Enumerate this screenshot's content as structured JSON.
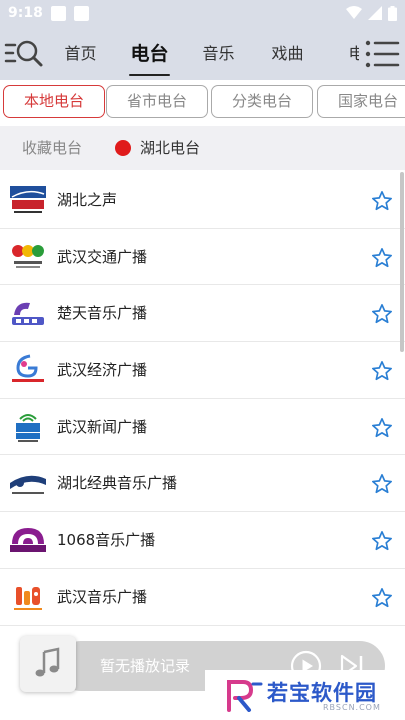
{
  "status_bar": {
    "time": "9:18"
  },
  "header": {
    "tabs": [
      {
        "label": "首页"
      },
      {
        "label": "电台",
        "active": true
      },
      {
        "label": "音乐"
      },
      {
        "label": "戏曲"
      },
      {
        "label": "电"
      }
    ]
  },
  "categories": [
    {
      "label": "本地电台",
      "active": true
    },
    {
      "label": "省市电台"
    },
    {
      "label": "分类电台"
    },
    {
      "label": "国家电台"
    }
  ],
  "sub_header": {
    "favorites_label": "收藏电台",
    "current_station": "湖北电台"
  },
  "stations": [
    {
      "name": "湖北之声",
      "logo": "hubei-voice-logo"
    },
    {
      "name": "武汉交通广播",
      "logo": "wuhan-traffic-logo"
    },
    {
      "name": "楚天音乐广播",
      "logo": "chutian-music-logo"
    },
    {
      "name": "武汉经济广播",
      "logo": "wuhan-economy-logo"
    },
    {
      "name": "武汉新闻广播",
      "logo": "wuhan-news-logo"
    },
    {
      "name": "湖北经典音乐广播",
      "logo": "hubei-classic-music-logo"
    },
    {
      "name": "1068音乐广播",
      "logo": "music-1068-logo"
    },
    {
      "name": "武汉音乐广播",
      "logo": "wuhan-music-logo"
    }
  ],
  "player": {
    "status_text": "暂无播放记录"
  },
  "watermark": {
    "text": "若宝软件园",
    "sub": "RBSCN.COM"
  },
  "colors": {
    "accent_red": "#d63a3a",
    "star_blue": "#2a7fd4",
    "header_bg": "#d9dde7",
    "watermark_blue": "#2c59c9"
  }
}
